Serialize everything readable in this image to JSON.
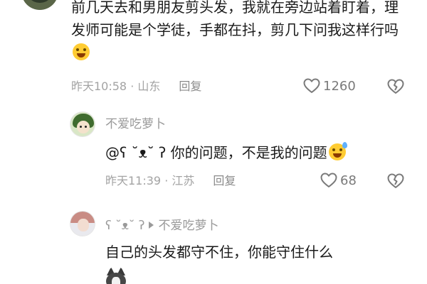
{
  "comment": {
    "body": "前几天去和男朋友剪头发，我就在旁边站着盯着，理发师可能是个学徒，手都在抖，剪几下问我这样行吗",
    "emoji": "laughing-crying-emoji",
    "time_location": "昨天10:58 · 山东",
    "reply_label": "回复",
    "like_count": "1260"
  },
  "replies": [
    {
      "username": "不爱吃萝卜",
      "body": "@ʕ ˘ᴥ˘ ʔ 你的问题，不是我的问题",
      "emoji": "grinning-sweat-emoji",
      "time_location": "昨天11:39 · 江苏",
      "reply_label": "回复",
      "like_count": "68"
    },
    {
      "username_from": "ʕ ˘ᴥ˘ ʔ",
      "username_to": "不爱吃萝卜",
      "body": "自己的头发都守不住，你能守住什么"
    }
  ],
  "icons": {
    "like": "heart-outline-icon",
    "dislike": "broken-heart-outline-icon",
    "reply_arrow": "play-arrow-icon"
  },
  "colors": {
    "meta_text": "#a3a3a3",
    "username_text": "#9a9a9a",
    "body_text": "#1a1a1a"
  }
}
